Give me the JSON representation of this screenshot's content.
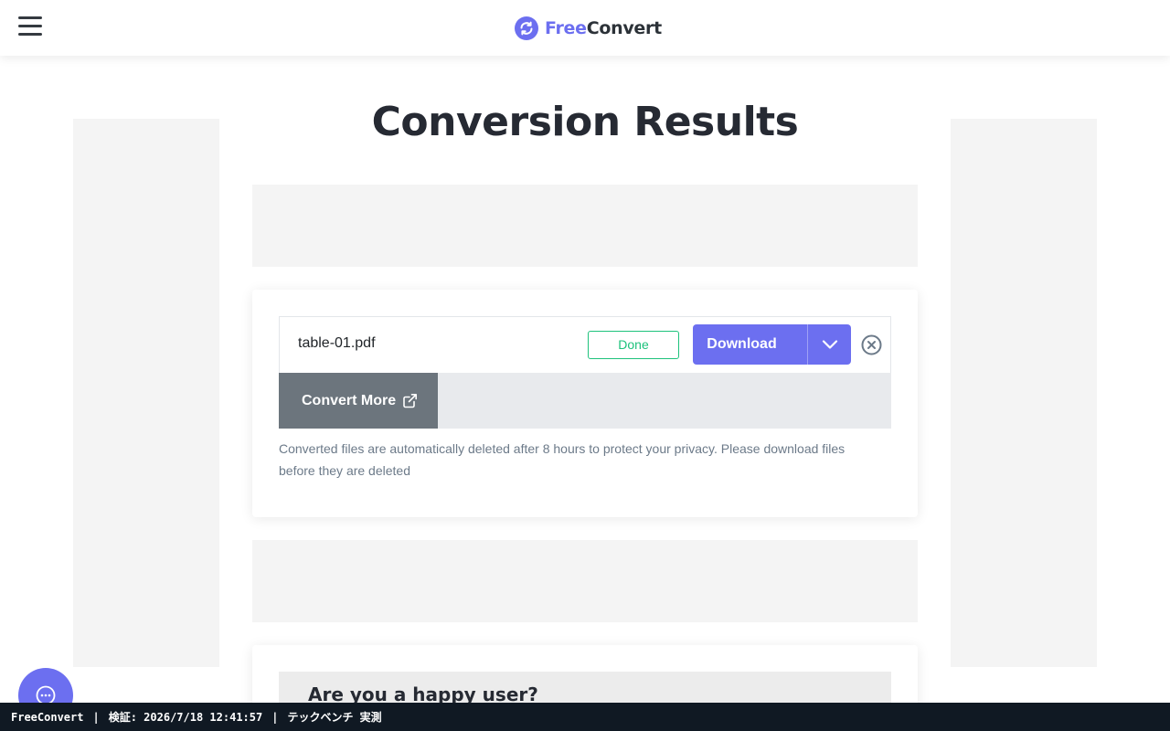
{
  "header": {
    "logo_free": "Free",
    "logo_convert": "Convert",
    "brand_color": "#6c6ff0",
    "menu_icon": "hamburger-icon"
  },
  "page": {
    "title": "Conversion Results"
  },
  "result": {
    "file_name": "table-01.pdf",
    "status": "Done",
    "status_color": "#1ec27c",
    "download_label": "Download",
    "convert_more_label": "Convert More",
    "note": "Converted files are automatically deleted after 8 hours to protect your privacy. Please download files before they are deleted"
  },
  "feedback": {
    "title": "Are you a happy user?"
  },
  "footer": {
    "app": "FreeConvert",
    "verified": "検証: 2026/7/18 12:41:57",
    "credit": "テックベンチ 実測"
  }
}
